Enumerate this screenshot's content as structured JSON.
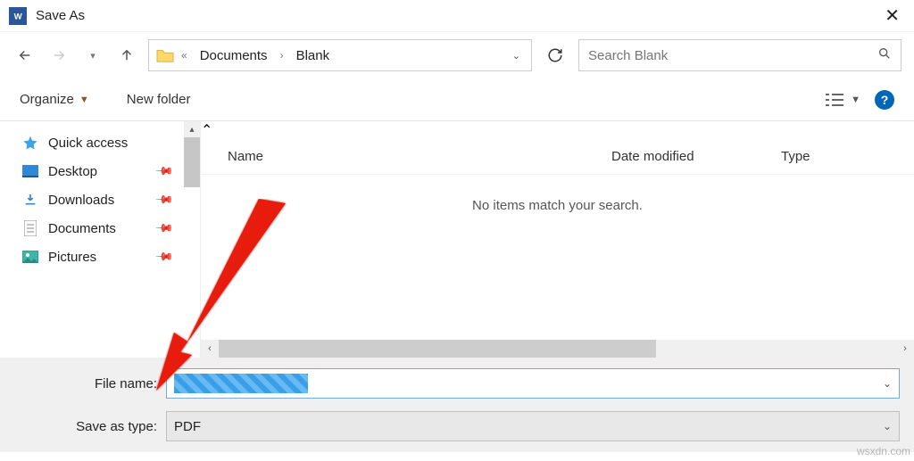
{
  "titlebar": {
    "title": "Save As"
  },
  "nav": {
    "crumbs": [
      "Documents",
      "Blank"
    ],
    "search_placeholder": "Search Blank"
  },
  "toolbar": {
    "organize": "Organize",
    "newfolder": "New folder"
  },
  "columns": {
    "name": "Name",
    "date": "Date modified",
    "type": "Type"
  },
  "empty_msg": "No items match your search.",
  "sidebar": {
    "quick_access": "Quick access",
    "items": [
      {
        "label": "Desktop"
      },
      {
        "label": "Downloads"
      },
      {
        "label": "Documents"
      },
      {
        "label": "Pictures"
      }
    ]
  },
  "form": {
    "filename_label": "File name:",
    "type_label": "Save as type:",
    "type_value": "PDF"
  },
  "watermark": "wsxdn.com"
}
